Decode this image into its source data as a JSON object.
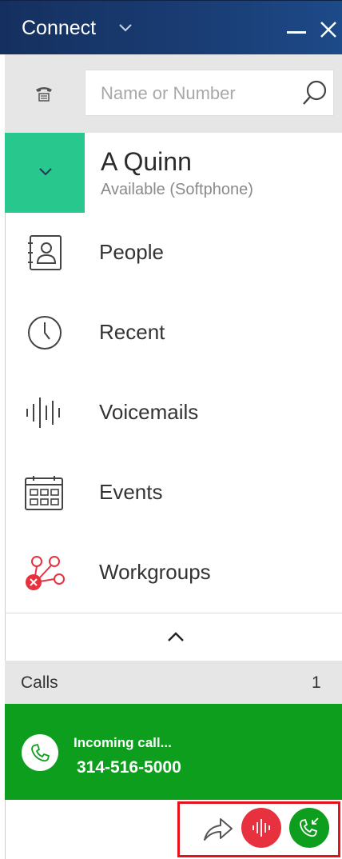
{
  "window": {
    "title": "Connect",
    "title_menu_icon": "chevron-down-icon",
    "minimize_icon": "minimize-icon",
    "close_icon": "close-icon",
    "titlebar_color": "#1a3d75"
  },
  "search": {
    "dialpad_icon": "telephone-icon",
    "placeholder": "Name or Number",
    "value": "",
    "search_icon": "search-icon"
  },
  "user": {
    "name": "A Quinn",
    "status": "Available (Softphone)",
    "status_color": "#27c78e",
    "toggle_icon": "chevron-down-icon"
  },
  "nav": {
    "items": [
      {
        "label": "People",
        "icon": "contacts-book-icon"
      },
      {
        "label": "Recent",
        "icon": "clock-icon"
      },
      {
        "label": "Voicemails",
        "icon": "voicemail-waveform-icon"
      },
      {
        "label": "Events",
        "icon": "calendar-icon"
      },
      {
        "label": "Workgroups",
        "icon": "workgroups-icon",
        "badge_color": "#e8313f"
      }
    ],
    "collapse_icon": "chevron-up-icon"
  },
  "calls": {
    "header_label": "Calls",
    "count": "1",
    "incoming": {
      "status": "Incoming call...",
      "number": "314-516-5000",
      "card_color": "#0d9e1e",
      "icon": "phone-icon"
    },
    "actions": {
      "forward_icon": "forward-arrow-icon",
      "voicemail_icon": "voicemail-waveform-icon",
      "voicemail_color": "#e8313f",
      "answer_icon": "answer-call-icon",
      "answer_color": "#0d9e1e",
      "highlight_color": "#e8101a"
    }
  }
}
